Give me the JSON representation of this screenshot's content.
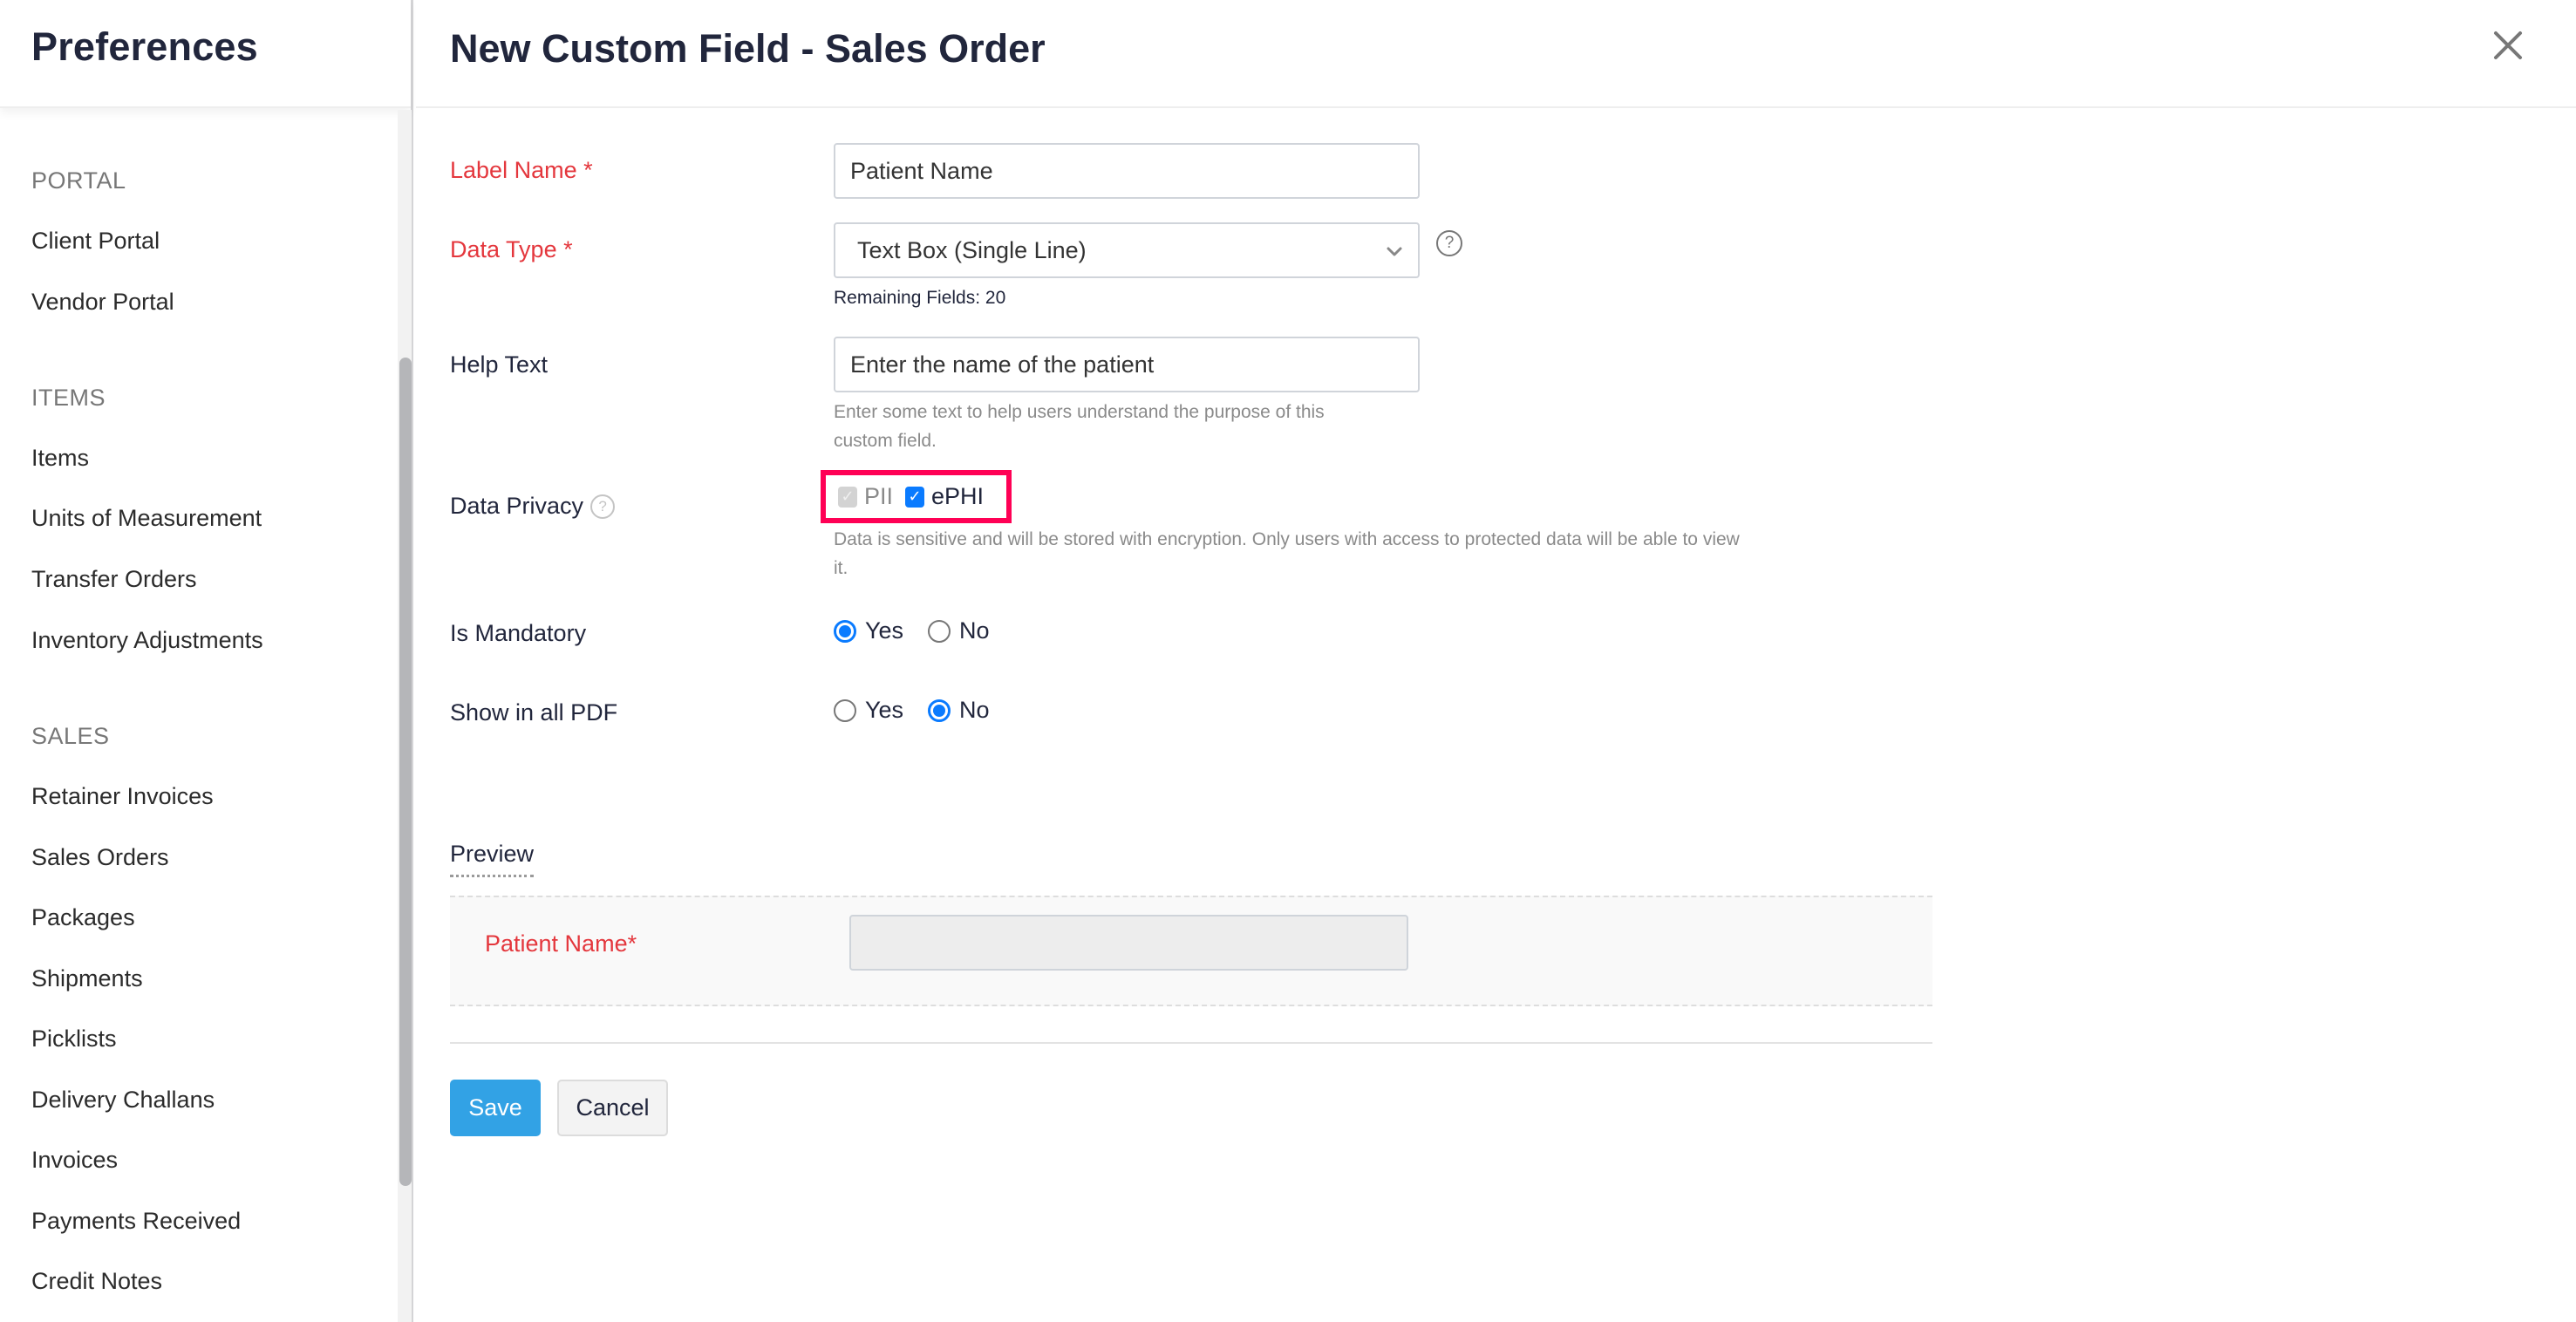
{
  "sidebar": {
    "title": "Preferences",
    "groups": [
      {
        "label": "PORTAL",
        "items": [
          "Client Portal",
          "Vendor Portal"
        ]
      },
      {
        "label": "ITEMS",
        "items": [
          "Items",
          "Units of Measurement",
          "Transfer Orders",
          "Inventory Adjustments"
        ]
      },
      {
        "label": "SALES",
        "items": [
          "Retainer Invoices",
          "Sales Orders",
          "Packages",
          "Shipments",
          "Picklists",
          "Delivery Challans",
          "Invoices",
          "Payments Received",
          "Credit Notes"
        ]
      }
    ]
  },
  "header": {
    "title": "New Custom Field - Sales Order",
    "close_icon": "close-icon"
  },
  "form": {
    "label_name": {
      "label": "Label Name *",
      "value": "Patient Name"
    },
    "data_type": {
      "label": "Data Type *",
      "selected": "Text Box (Single Line)",
      "help_icon": "?",
      "remaining": "Remaining Fields: 20"
    },
    "help_text": {
      "label": "Help Text",
      "value": "Enter the name of the patient",
      "hint_line1": "Enter some text to help users understand the purpose of this",
      "hint_line2": "custom field."
    },
    "data_privacy": {
      "label": "Data Privacy",
      "help_icon": "?",
      "options": [
        {
          "label": "PII",
          "checked": true,
          "disabled": true
        },
        {
          "label": "ePHI",
          "checked": true,
          "disabled": false
        }
      ],
      "check_glyph": "✓",
      "note_line1": "Data is sensitive and will be stored with encryption. Only users with access to protected data will be able to view",
      "note_line2": "it.",
      "highlight_color": "#ff0055"
    },
    "is_mandatory": {
      "label": "Is Mandatory",
      "options": [
        "Yes",
        "No"
      ],
      "selected": "Yes"
    },
    "show_in_pdf": {
      "label": "Show in all PDF",
      "options": [
        "Yes",
        "No"
      ],
      "selected": "No"
    }
  },
  "preview": {
    "title": "Preview",
    "field_label": "Patient Name*"
  },
  "actions": {
    "save_label": "Save",
    "cancel_label": "Cancel"
  },
  "colors": {
    "accent": "#0a7bff",
    "save_button": "#32a2e5",
    "required_label": "#e4373d"
  }
}
